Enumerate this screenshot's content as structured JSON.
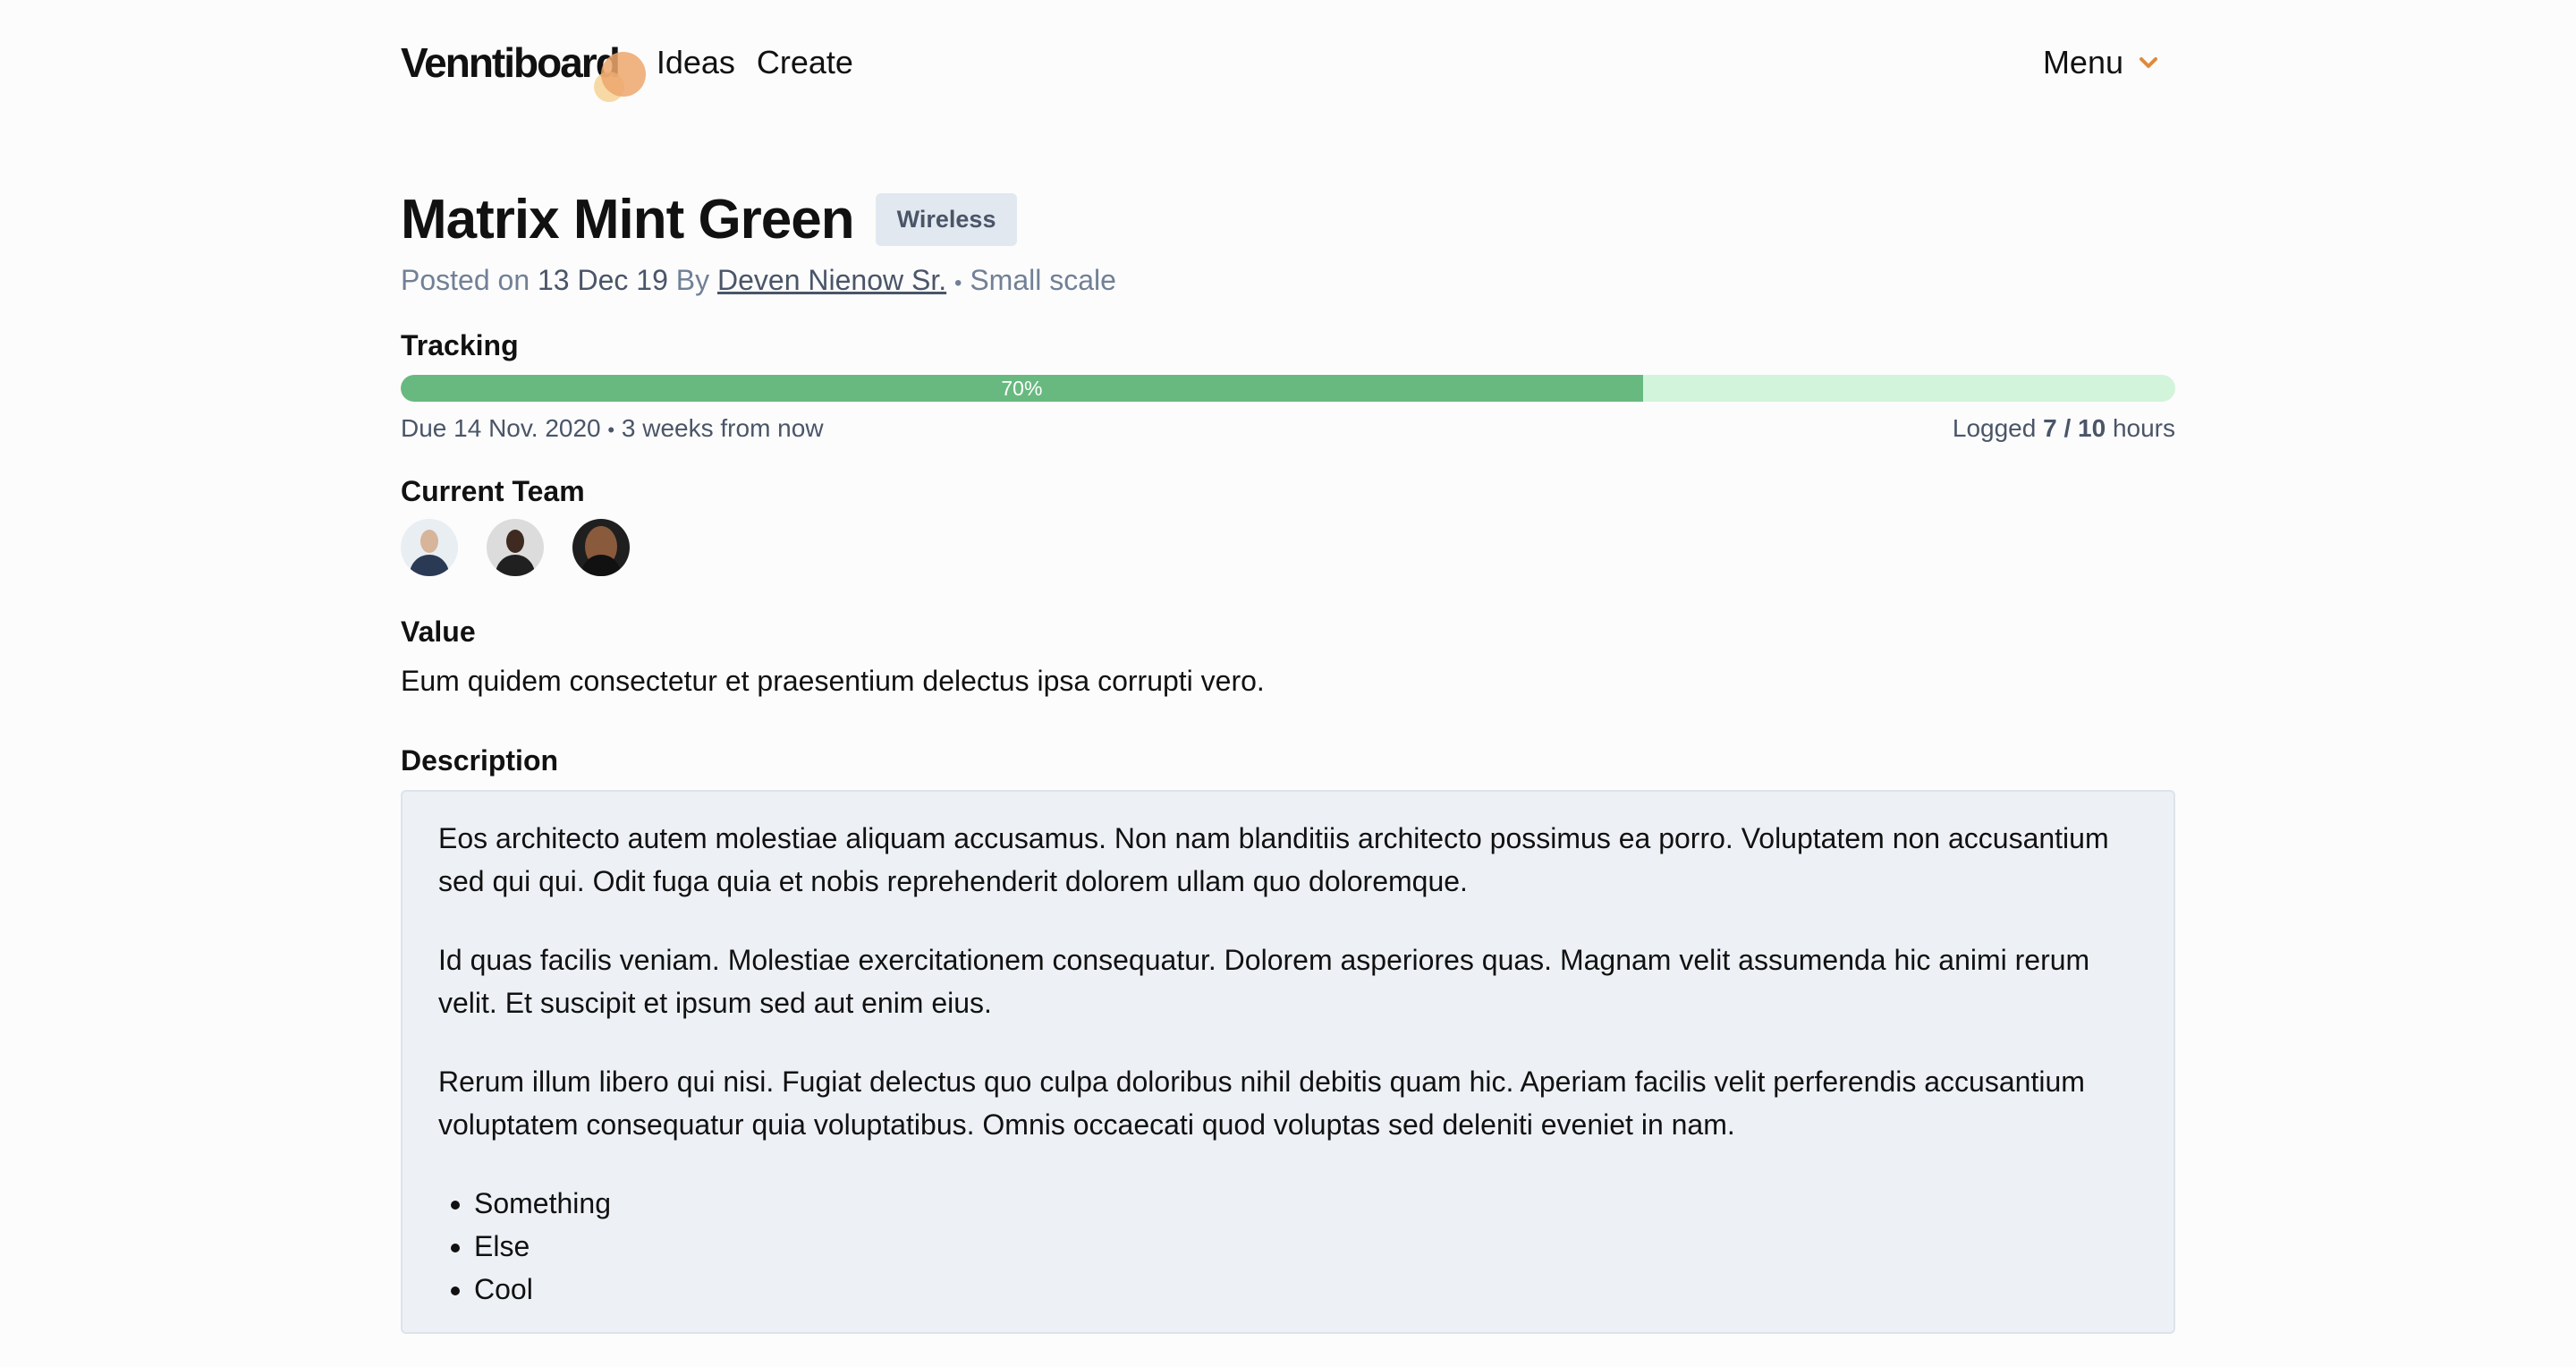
{
  "header": {
    "logo": "Venntiboard",
    "nav": [
      "Ideas",
      "Create"
    ],
    "menu_label": "Menu"
  },
  "idea": {
    "title": "Matrix Mint Green",
    "badge": "Wireless",
    "posted_prefix": "Posted on",
    "posted_date": "13 Dec 19",
    "by_label": "By",
    "author": "Deven Nienow Sr.",
    "separator": "•",
    "scale": "Small scale"
  },
  "tracking": {
    "label": "Tracking",
    "progress_percent": 70,
    "progress_text": "70%",
    "due": "Due 14 Nov. 2020",
    "due_relative": "3 weeks from now",
    "logged_prefix": "Logged",
    "logged_value": "7 / 10",
    "logged_suffix": "hours"
  },
  "team": {
    "label": "Current Team",
    "members": [
      "avatar-1",
      "avatar-2",
      "avatar-3"
    ]
  },
  "value": {
    "label": "Value",
    "text": "Eum quidem consectetur et praesentium delectus ipsa corrupti vero."
  },
  "description": {
    "label": "Description",
    "paragraphs": [
      "Eos architecto autem molestiae aliquam accusamus. Non nam blanditiis architecto possimus ea porro. Voluptatem non accusantium sed qui qui. Odit fuga quia et nobis reprehenderit dolorem ullam quo doloremque.",
      "Id quas facilis veniam. Molestiae exercitationem consequatur. Dolorem asperiores quas. Magnam velit assumenda hic animi rerum velit. Et suscipit et ipsum sed aut enim eius.",
      "Rerum illum libero qui nisi. Fugiat delectus quo culpa doloribus nihil debitis quam hic. Aperiam facilis velit perferendis accusantium voluptatem consequatur quia voluptatibus. Omnis occaecati quod voluptas sed deleniti eveniet in nam."
    ],
    "list": [
      "Something",
      "Else",
      "Cool"
    ]
  },
  "colors": {
    "accent": "#eda66c",
    "progress_fill": "#68b97f",
    "progress_track": "#d2f4db",
    "badge_bg": "#e2e8f0",
    "description_bg": "#edf1f6"
  }
}
